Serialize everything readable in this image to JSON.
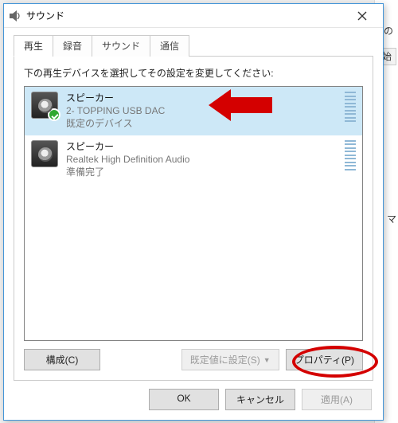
{
  "backdrop": {
    "frag1": "の",
    "frag2": "、マ",
    "frag3": "始"
  },
  "window": {
    "title": "サウンド",
    "tabs": [
      "再生",
      "録音",
      "サウンド",
      "通信"
    ],
    "instruction": "下の再生デバイスを選択してその設定を変更してください:",
    "devices": [
      {
        "name": "スピーカー",
        "driver": "2- TOPPING USB DAC",
        "status": "既定のデバイス",
        "default": true,
        "selected": true
      },
      {
        "name": "スピーカー",
        "driver": "Realtek High Definition Audio",
        "status": "準備完了",
        "default": false,
        "selected": false
      }
    ],
    "buttons": {
      "configure": "構成(C)",
      "set_default": "既定値に設定(S)",
      "properties": "プロパティ(P)",
      "ok": "OK",
      "cancel": "キャンセル",
      "apply": "適用(A)"
    }
  }
}
